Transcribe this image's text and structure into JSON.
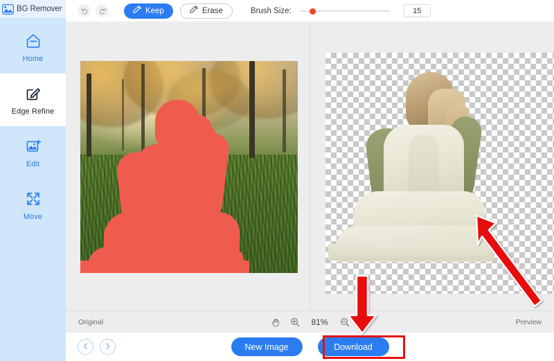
{
  "app": {
    "brand_name": "BG Remover",
    "logo_icon": "image-logo-icon"
  },
  "sidebar": {
    "items": [
      {
        "label": "Home",
        "icon": "home-icon",
        "active": false
      },
      {
        "label": "Edge Refine",
        "icon": "edge-refine-icon",
        "active": true
      },
      {
        "label": "Edit",
        "icon": "edit-image-icon",
        "active": false
      },
      {
        "label": "Move",
        "icon": "move-icon",
        "active": false
      }
    ]
  },
  "toolbar": {
    "undo_icon": "undo-icon",
    "redo_icon": "redo-icon",
    "keep_label": "Keep",
    "keep_icon": "brush-keep-icon",
    "erase_label": "Erase",
    "erase_icon": "brush-erase-icon",
    "brush_size_label": "Brush Size:",
    "brush_size_value": "15",
    "brush_slider_min": "1",
    "brush_slider_max": "100",
    "brush_slider_position_pct": 12
  },
  "workspace": {
    "left_pane_name": "original-image-pane",
    "right_pane_name": "preview-image-pane"
  },
  "statusbar": {
    "original_label": "Original",
    "preview_label": "Preview",
    "zoom_level": "81%",
    "hand_icon": "hand-tool-icon",
    "zoom_in_icon": "zoom-in-icon",
    "zoom_out_icon": "zoom-out-icon"
  },
  "bottombar": {
    "prev_icon": "chevron-left-icon",
    "next_icon": "chevron-right-icon",
    "new_image_label": "New Image",
    "download_label": "Download"
  },
  "annotations": {
    "highlight_color": "#e8100f",
    "arrow_color": "#e8100f",
    "down_arrow_target": "download-button",
    "diagonal_arrow_target": "preview-cutout"
  },
  "colors": {
    "accent_blue": "#2b7cf0",
    "sidebar_bg": "#cfe6fb",
    "workspace_bg": "#ededed",
    "mask_red": "#ef5c4d",
    "slider_thumb": "#f2422e"
  }
}
